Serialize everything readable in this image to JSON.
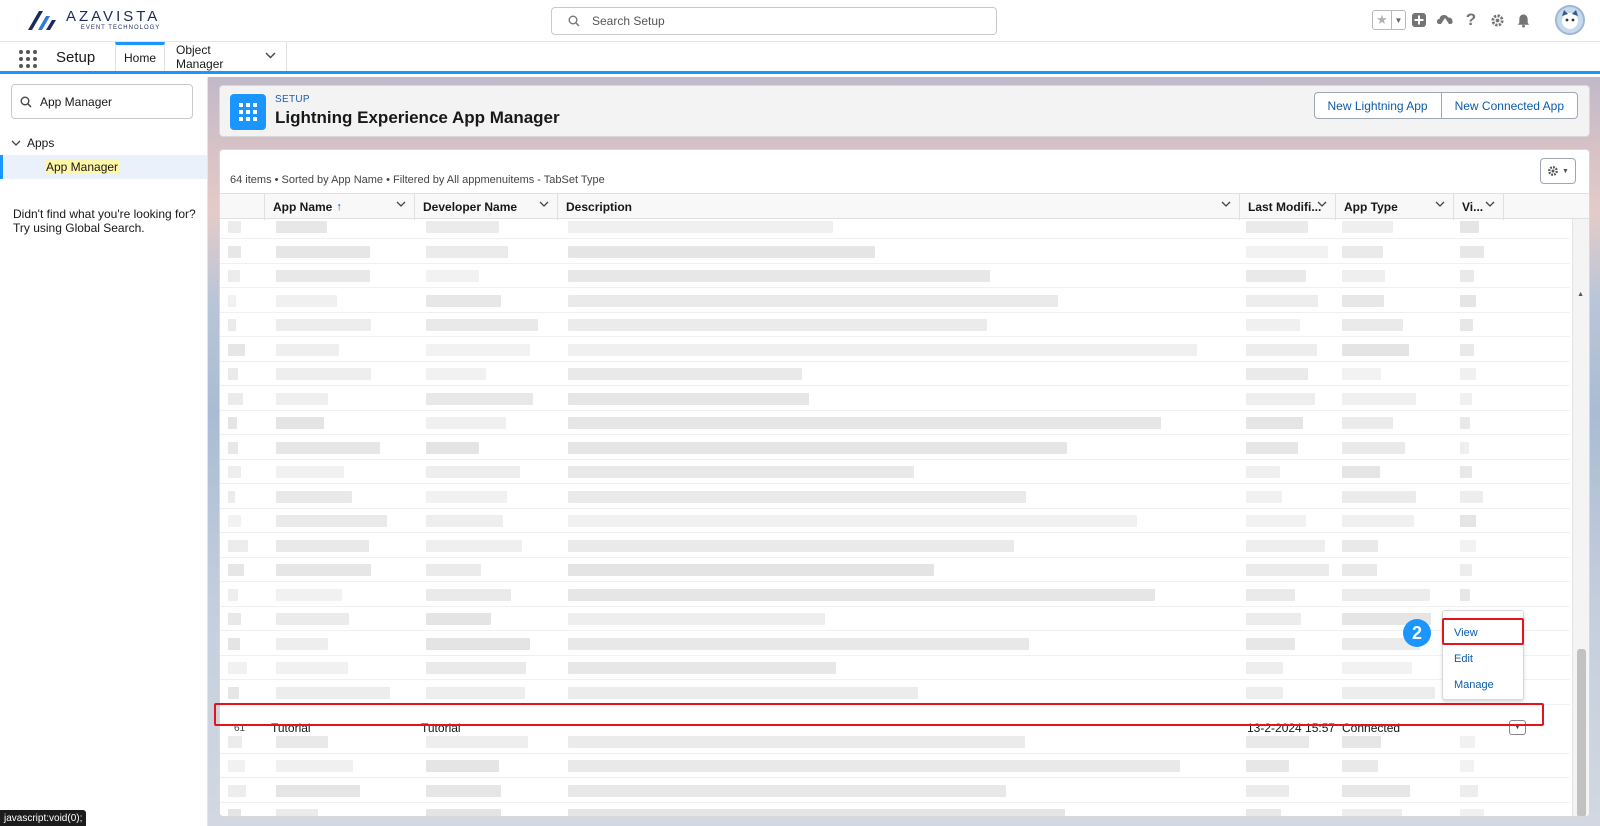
{
  "brand": {
    "name": "AZAVISTA",
    "tagline": "EVENT TECHNOLOGY"
  },
  "global_search": {
    "placeholder": "Search Setup"
  },
  "nav": {
    "app_name": "Setup",
    "tabs": [
      {
        "label": "Home",
        "active": true
      },
      {
        "label": "Object Manager",
        "active": false
      }
    ]
  },
  "sidebar": {
    "search_value": "App Manager",
    "group_label": "Apps",
    "item_label": "App Manager",
    "help_line1": "Didn't find what you're looking for?",
    "help_line2": "Try using Global Search."
  },
  "page_header": {
    "eyebrow": "SETUP",
    "title": "Lightning Experience App Manager",
    "buttons": {
      "new_lightning": "New Lightning App",
      "new_connected": "New Connected App"
    }
  },
  "list": {
    "meta": "64 items • Sorted by App Name • Filtered by All appmenuitems - TabSet Type",
    "columns": {
      "app_name": "App Name",
      "developer_name": "Developer Name",
      "description": "Description",
      "last_modified": "Last Modifi...",
      "app_type": "App Type",
      "visible": "Vi..."
    },
    "highlighted_row": {
      "number": "61",
      "app_name": "Tutorial",
      "developer_name": "Tutorial",
      "last_modified": "13-2-2024 15:57",
      "app_type": "Connected"
    }
  },
  "row_menu": {
    "items": [
      "View",
      "Edit",
      "Manage"
    ]
  },
  "step_badge": "2",
  "status_bar": "javascript:void(0);",
  "colors": {
    "brand_blue": "#1b96ff",
    "link_blue": "#0b5cab",
    "highlight_red": "#e3151c"
  }
}
